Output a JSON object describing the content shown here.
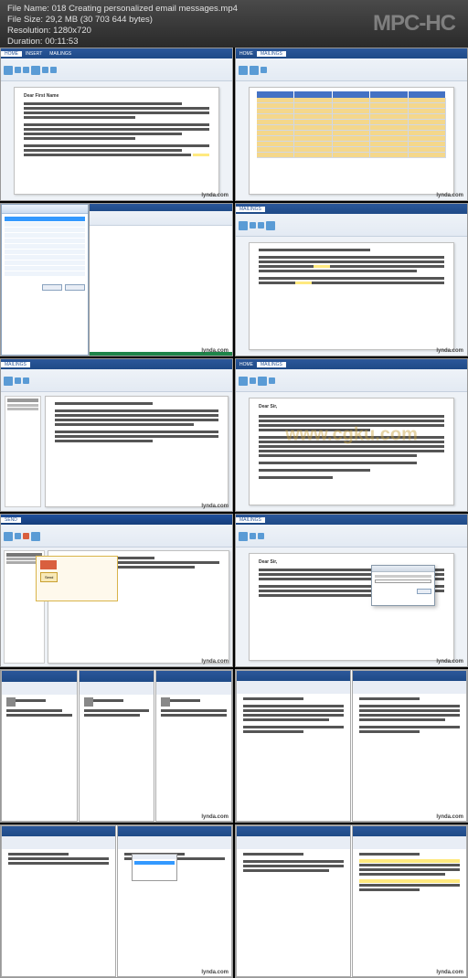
{
  "player": {
    "file_name_label": "File Name:",
    "file_name": "018 Creating personalized email messages.mp4",
    "file_size_label": "File Size:",
    "file_size": "29,2 MB (30 703 644 bytes)",
    "resolution_label": "Resolution:",
    "resolution": "1280x720",
    "duration_label": "Duration:",
    "duration": "00:11:53",
    "logo": "MPC-HC"
  },
  "watermark": "www.cgku.com",
  "lynda_brand": "lynda.com",
  "thumb1": {
    "title": "Dear First Name"
  },
  "thumb6": {
    "salutation": "Dear Sir,"
  },
  "thumb8": {
    "salutation": "Dear Sir,",
    "send_label": "Send"
  }
}
